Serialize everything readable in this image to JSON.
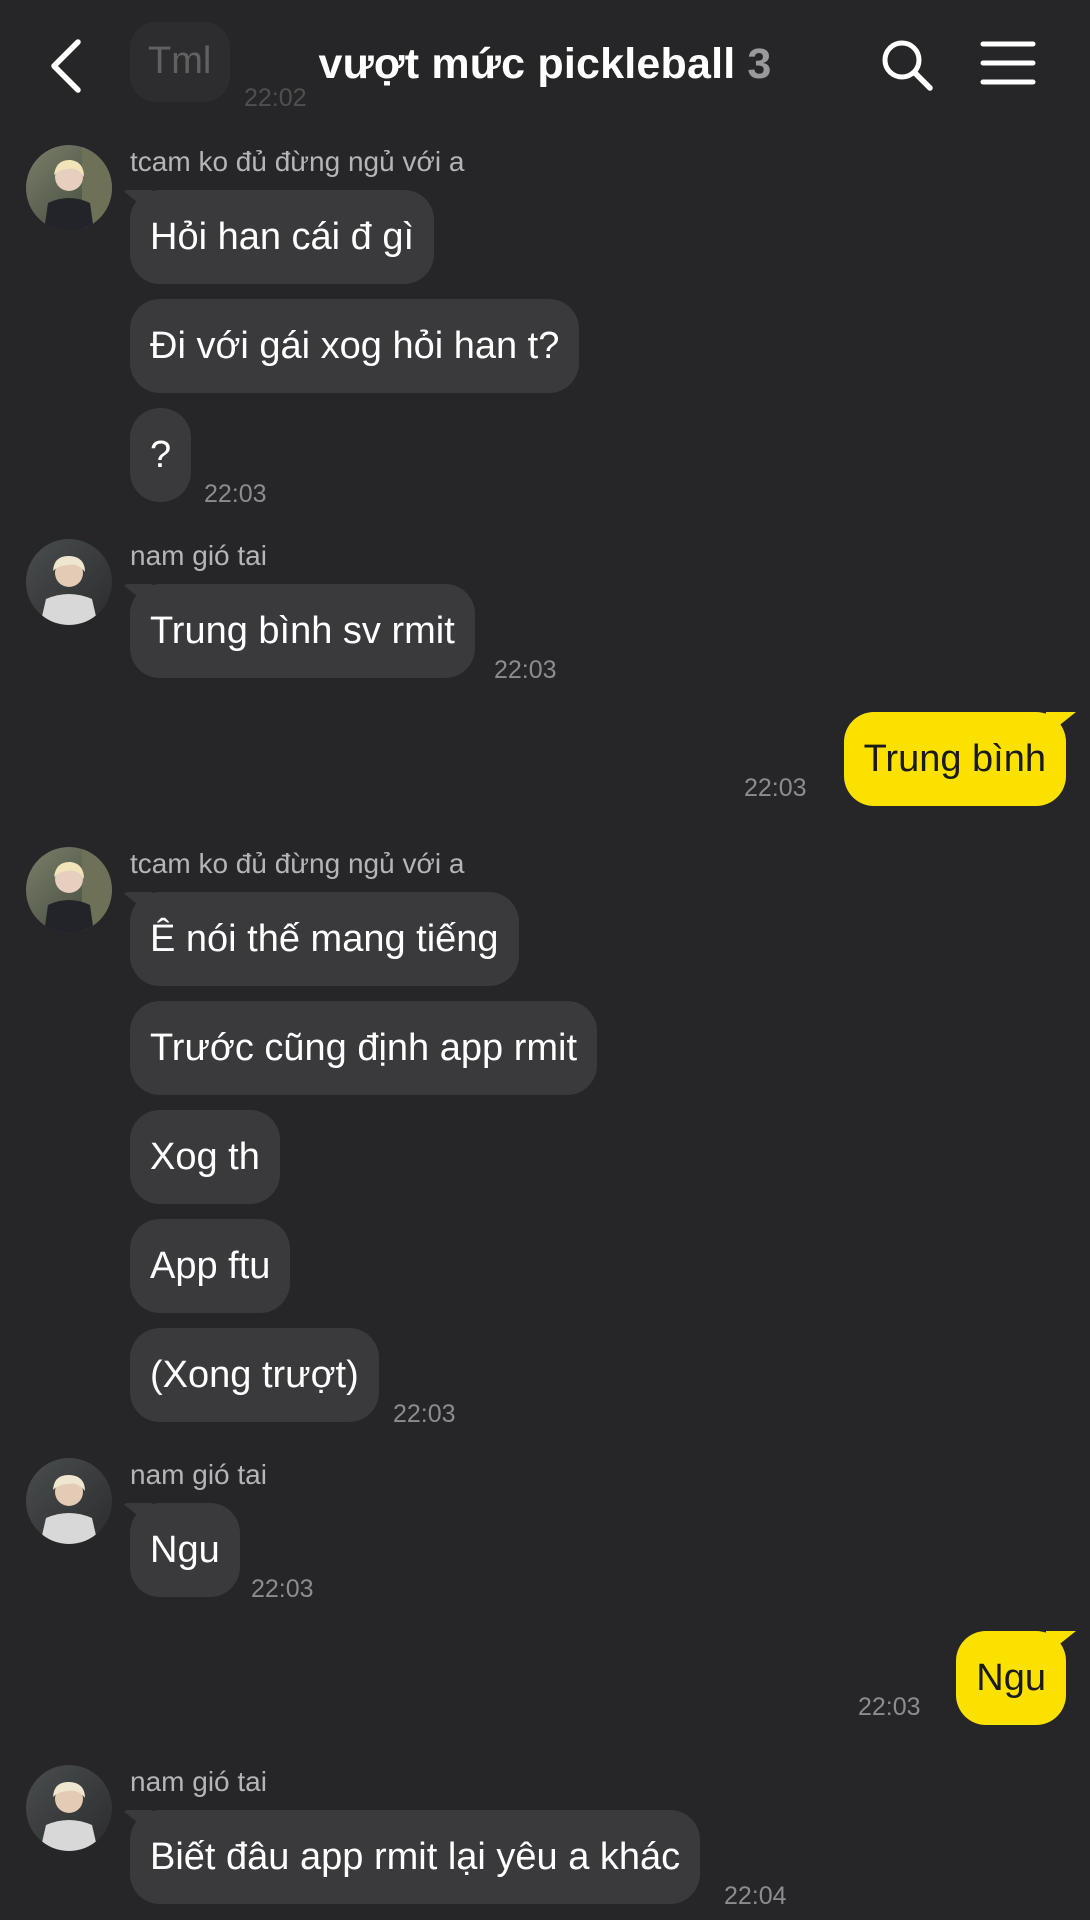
{
  "header": {
    "title": "vượt mức pickleball",
    "member_count": "3",
    "partial_message": "Tml",
    "partial_time": "22:02"
  },
  "groups": [
    {
      "sender": "tcam ko đủ đừng ngủ với a",
      "messages": [
        "Hỏi han cái đ gì",
        "Đi với gái xog hỏi han t?",
        "?"
      ],
      "time": "22:03"
    },
    {
      "sender": "nam gió tai",
      "messages": [
        "Trung bình sv rmit"
      ],
      "time": "22:03"
    },
    {
      "sender": "me",
      "messages": [
        "Trung bình"
      ],
      "time": "22:03"
    },
    {
      "sender": "tcam ko đủ đừng ngủ với a",
      "messages": [
        "Ê nói thế mang tiếng",
        "Trước cũng định app rmit",
        "Xog th",
        "App ftu",
        "(Xong trượt)"
      ],
      "time": "22:03"
    },
    {
      "sender": "nam gió tai",
      "messages": [
        "Ngu"
      ],
      "time": "22:03"
    },
    {
      "sender": "me",
      "messages": [
        "Ngu"
      ],
      "time": "22:03"
    },
    {
      "sender": "nam gió tai",
      "messages": [
        "Biết đâu app rmit lại yêu a khác"
      ],
      "time": "22:04"
    }
  ],
  "colors": {
    "background": "#262628",
    "bubble_other": "#3a3a3d",
    "bubble_mine": "#fae100"
  }
}
